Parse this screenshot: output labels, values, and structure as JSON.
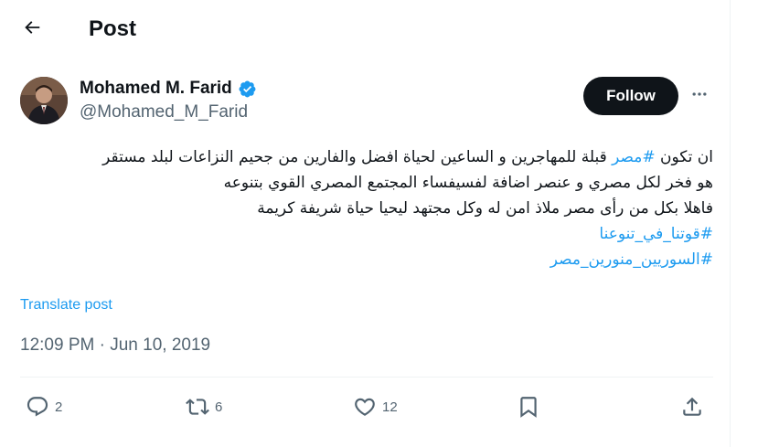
{
  "header": {
    "title": "Post",
    "back_icon": "arrow-left-icon"
  },
  "author": {
    "name": "Mohamed M. Farid",
    "handle": "@Mohamed_M_Farid",
    "verified_icon": "verified-badge-icon",
    "verified_color": "#1d9bf0"
  },
  "follow_label": "Follow",
  "more_icon": "more-horizontal-icon",
  "tweet": {
    "line1_a": "ان تكون ",
    "line1_hashtag": "#مصر",
    "line1_b": " قبلة للمهاجرين و الساعين لحياة افضل والفارين من جحيم النزاعات لبلد مستقر",
    "line2": "هو فخر لكل مصري و عنصر اضافة لفسيفساء المجتمع المصري القوي بتنوعه",
    "line3": "فاهلا بكل من رأى مصر ملاذ امن له وكل مجتهد ليحيا حياة شريفة كريمة",
    "hashtag1": "#قوتنا_في_تنوعنا",
    "hashtag2": "#السوريين_منورين_مصر"
  },
  "translate_label": "Translate post",
  "timestamp": "12:09 PM · Jun 10, 2019",
  "actions": {
    "replies": "2",
    "reposts": "6",
    "likes": "12"
  },
  "colors": {
    "accent": "#1d9bf0",
    "text": "#0f1419",
    "secondary": "#536471"
  }
}
